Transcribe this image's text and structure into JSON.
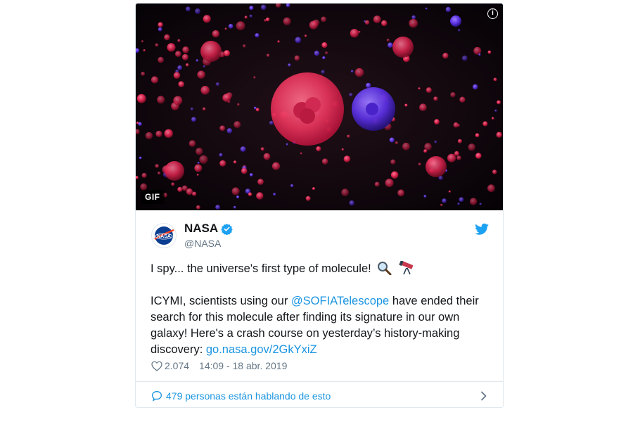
{
  "media": {
    "badge_label": "GIF",
    "info_icon": "info-icon",
    "info_symbol": "i"
  },
  "tweet": {
    "display_name": "NASA",
    "handle": "@NASA",
    "verified_icon": "verified-badge-icon",
    "brand_icon": "twitter-bird-icon",
    "line1": "I spy... the universe's first type of molecule!",
    "line1_emoji": [
      "magnifying-glass-icon",
      "telescope-icon"
    ],
    "body_prefix": "ICYMI, scientists using our ",
    "body_mention": "@SOFIATelescope",
    "body_middle": " have ended their search for this molecule after finding its signature in our own galaxy! Here's a crash course on yesterday’s history-making discovery: ",
    "body_link": "go.nasa.gov/2GkYxiZ",
    "likes": "2.074",
    "timestamp": "14:09 - 18 abr. 2019"
  },
  "footer": {
    "conversation_label": "479 personas están hablando de esto"
  },
  "colors": {
    "link": "#1b95e0",
    "secondary_text": "#657786",
    "border": "#e1e8ed",
    "nasa_blue": "#0b3d91",
    "nasa_red": "#fc3d21"
  }
}
